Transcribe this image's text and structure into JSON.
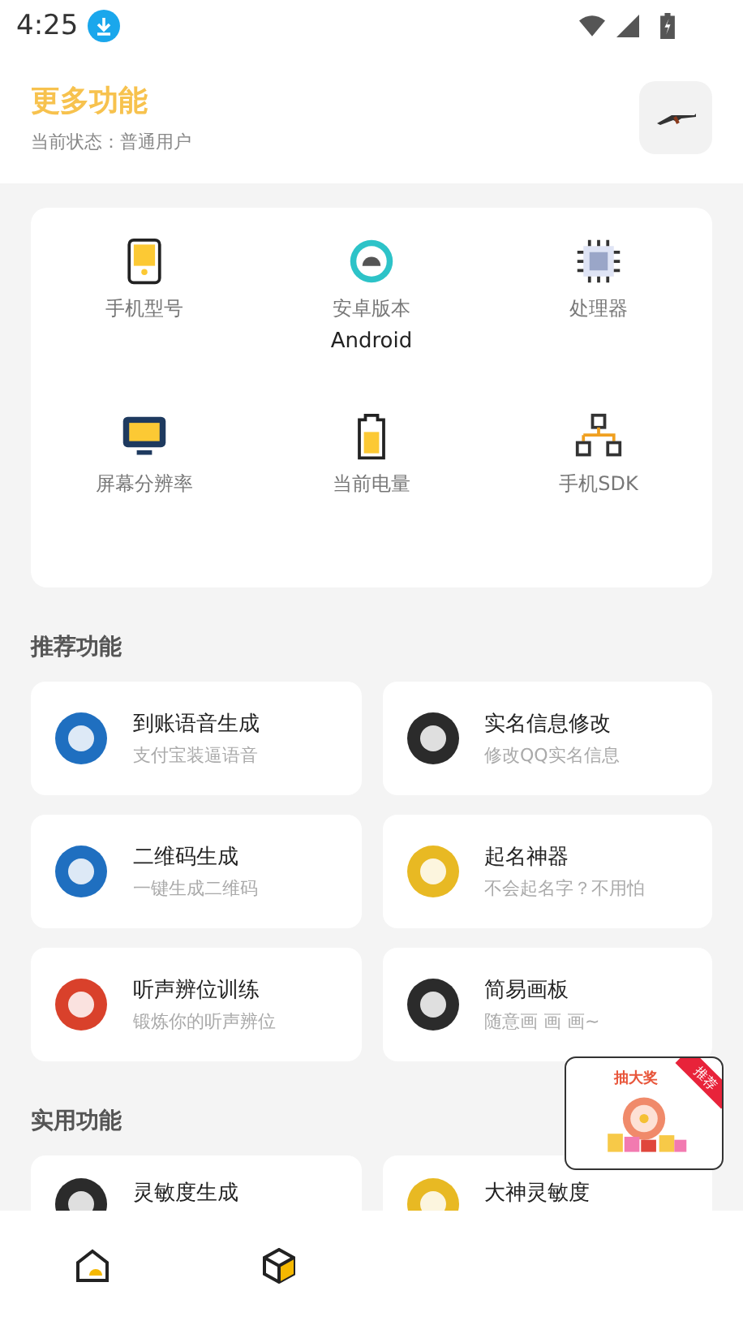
{
  "status_bar": {
    "time": "4:25"
  },
  "header": {
    "title": "更多功能",
    "status": "当前状态：普通用户"
  },
  "device_info": [
    {
      "kind": "phone",
      "label": "手机型号"
    },
    {
      "kind": "android",
      "label": "安卓版本",
      "value": "Android"
    },
    {
      "kind": "cpu",
      "label": "处理器"
    },
    {
      "kind": "screen",
      "label": "屏幕分辨率"
    },
    {
      "kind": "battery",
      "label": "当前电量"
    },
    {
      "kind": "sdk",
      "label": "手机SDK"
    }
  ],
  "sections": [
    {
      "title": "推荐功能",
      "items": [
        {
          "title": "到账语音生成",
          "subtitle": "支付宝装逼语音",
          "color": "#1f6fc0"
        },
        {
          "title": "实名信息修改",
          "subtitle": "修改QQ实名信息",
          "color": "#2b2b2b"
        },
        {
          "title": "二维码生成",
          "subtitle": "一键生成二维码",
          "color": "#1f6fc0"
        },
        {
          "title": "起名神器",
          "subtitle": "不会起名字？不用怕",
          "color": "#e8b923"
        },
        {
          "title": "听声辨位训练",
          "subtitle": "锻炼你的听声辨位",
          "color": "#d9412b"
        },
        {
          "title": "简易画板",
          "subtitle": "随意画 画 画~",
          "color": "#2b2b2b"
        }
      ]
    },
    {
      "title": "实用功能",
      "items": [
        {
          "title": "灵敏度生成",
          "color": "#2b2b2b"
        },
        {
          "title": "大神灵敏度",
          "color": "#e8b923"
        }
      ]
    }
  ],
  "promo": {
    "title": "抽大奖",
    "ribbon": "推荐"
  },
  "bottom_nav": [
    {
      "kind": "home"
    },
    {
      "kind": "box"
    }
  ]
}
